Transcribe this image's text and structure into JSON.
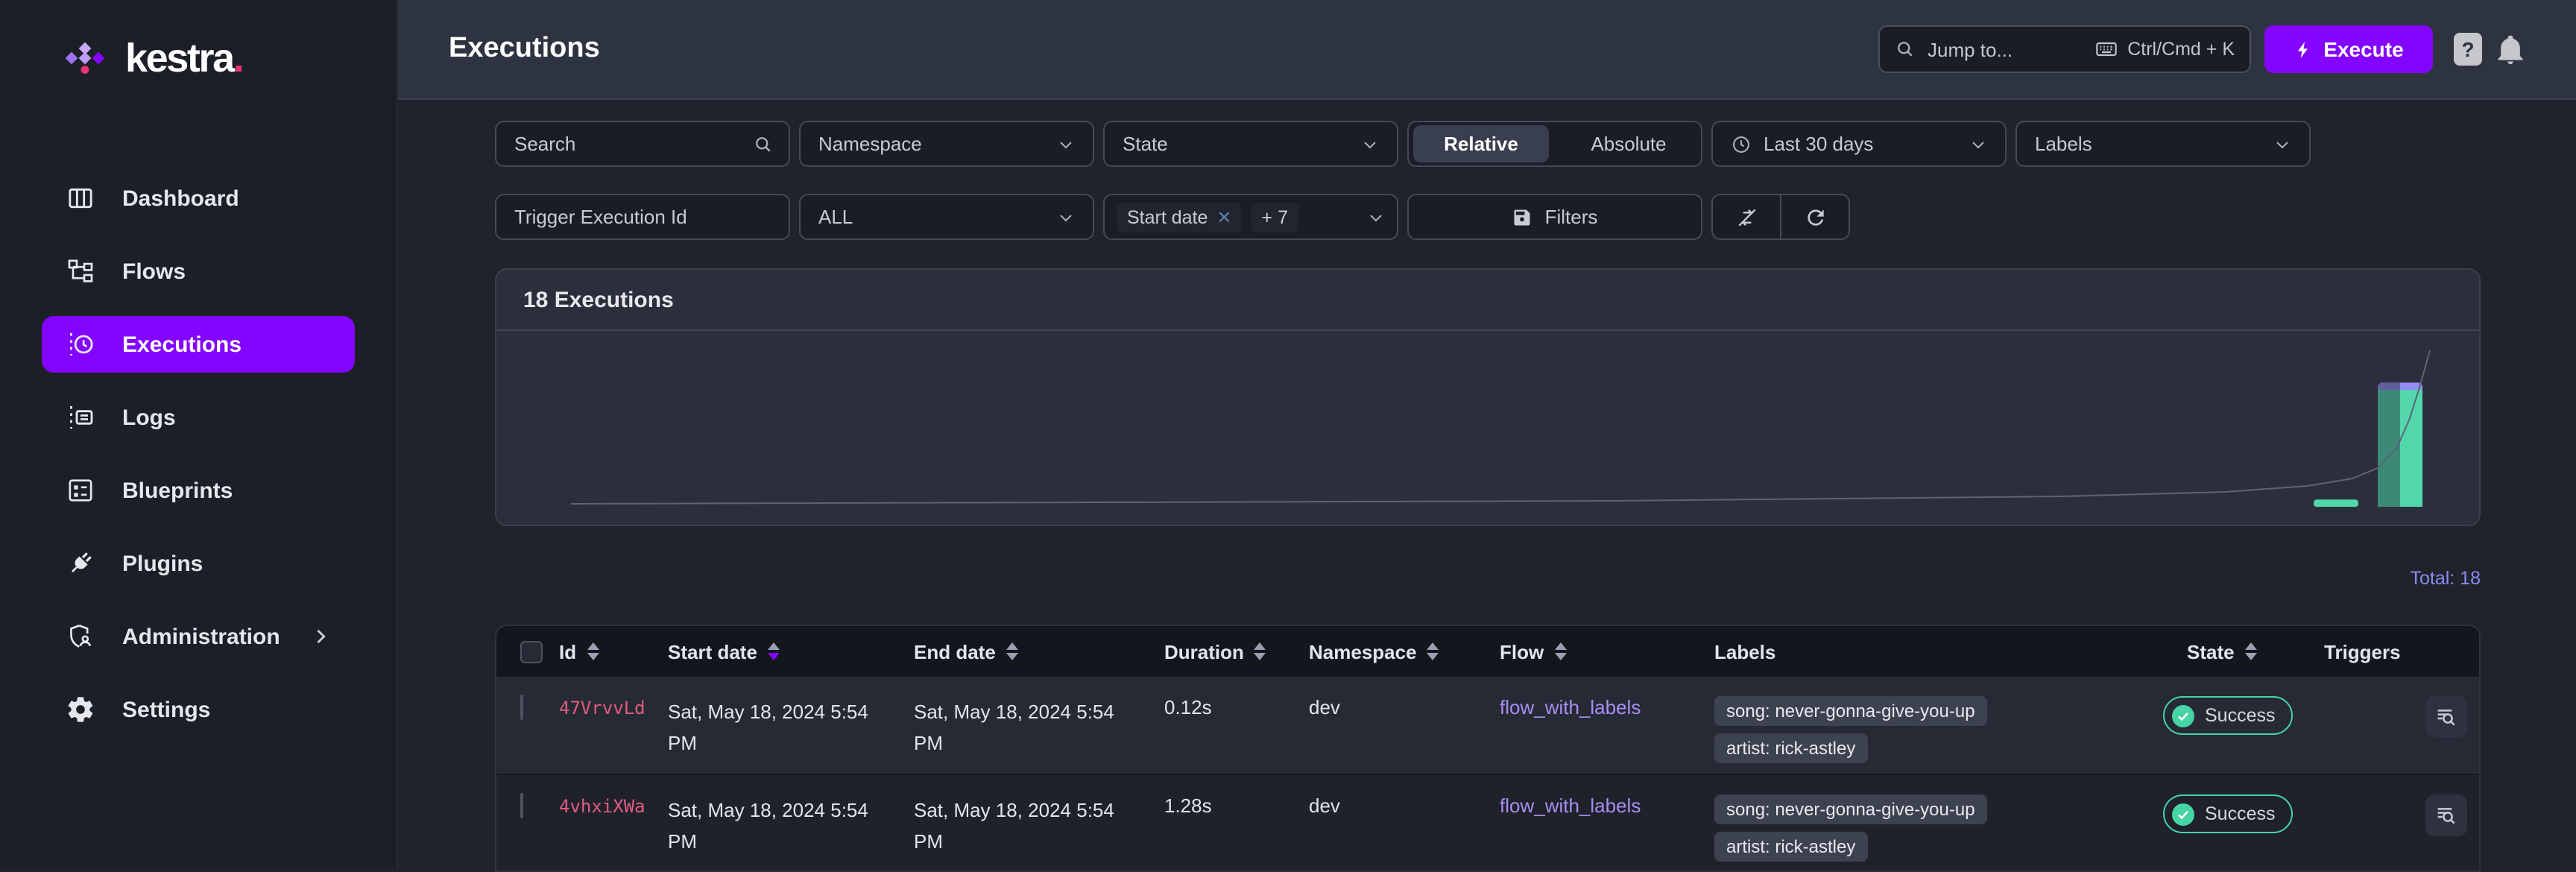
{
  "brand": {
    "name": "kestra",
    "dot": "."
  },
  "colors": {
    "accent": "#8405ff",
    "success": "#47d4a4",
    "flow_link": "#a98ef2",
    "execution_id": "#e25c80",
    "total_text": "#8b8af0",
    "topbar_bg": "#2e3340",
    "page_bg": "#20232c"
  },
  "sidebar": {
    "items": [
      {
        "label": "Dashboard"
      },
      {
        "label": "Flows"
      },
      {
        "label": "Executions",
        "active": true
      },
      {
        "label": "Logs"
      },
      {
        "label": "Blueprints"
      },
      {
        "label": "Plugins"
      },
      {
        "label": "Administration",
        "expandable": true
      },
      {
        "label": "Settings"
      }
    ]
  },
  "topbar": {
    "title": "Executions",
    "jump_to": "Jump to...",
    "shortcut": "Ctrl/Cmd + K",
    "execute_label": "Execute",
    "help_label": "?"
  },
  "filters": {
    "search_placeholder": "Search",
    "namespace": "Namespace",
    "state": "State",
    "relative": "Relative",
    "absolute": "Absolute",
    "range": "Last 30 days",
    "labels": "Labels",
    "trigger_execution_id_placeholder": "Trigger Execution Id",
    "scope": "ALL",
    "date_chip": "Start date",
    "date_more": "+ 7",
    "filters_button": "Filters"
  },
  "summary": {
    "card_title": "18 Executions",
    "total": "Total: 18"
  },
  "chart_data": {
    "type": "bar",
    "title": "18 Executions",
    "total": 18,
    "xlabel": "time (axis labels hidden)",
    "ylabel": "executions (axis hidden)",
    "legend": "none",
    "grid": false,
    "series_colors": {
      "success": "#52d6ab",
      "created": "#918df2"
    },
    "bars": [
      {
        "x_frac": 0.928,
        "success": 1,
        "created": 0
      },
      {
        "x_frac": 0.96,
        "success": 16,
        "created": 1
      }
    ],
    "line": {
      "name": "cumulative total",
      "color": "#5d6377",
      "rises_to": 18,
      "points": [
        [
          50,
          116
        ],
        [
          400,
          115
        ],
        [
          750,
          114
        ],
        [
          1050,
          111
        ],
        [
          1160,
          108
        ],
        [
          1215,
          104
        ],
        [
          1245,
          99
        ],
        [
          1262,
          92
        ],
        [
          1275,
          78
        ],
        [
          1283,
          60
        ],
        [
          1290,
          38
        ],
        [
          1297,
          13
        ]
      ]
    }
  },
  "table": {
    "columns": [
      {
        "label": "Id",
        "sortable": true
      },
      {
        "label": "Start date",
        "sortable": true,
        "sorted": "desc"
      },
      {
        "label": "End date",
        "sortable": true
      },
      {
        "label": "Duration",
        "sortable": true
      },
      {
        "label": "Namespace",
        "sortable": true
      },
      {
        "label": "Flow",
        "sortable": true
      },
      {
        "label": "Labels",
        "sortable": false
      },
      {
        "label": "State",
        "sortable": true
      },
      {
        "label": "Triggers",
        "sortable": false
      }
    ],
    "rows": [
      {
        "id": "47VrvvLd",
        "start_date": "Sat, May 18, 2024 5:54 PM",
        "end_date": "Sat, May 18, 2024 5:54 PM",
        "duration": "0.12s",
        "namespace": "dev",
        "flow": "flow_with_labels",
        "labels": [
          "song: never-gonna-give-you-up",
          "artist: rick-astley"
        ],
        "state": "Success"
      },
      {
        "id": "4vhxiXWa",
        "start_date": "Sat, May 18, 2024 5:54 PM",
        "end_date": "Sat, May 18, 2024 5:54 PM",
        "duration": "1.28s",
        "namespace": "dev",
        "flow": "flow_with_labels",
        "labels": [
          "song: never-gonna-give-you-up",
          "artist: rick-astley"
        ],
        "state": "Success"
      }
    ]
  }
}
